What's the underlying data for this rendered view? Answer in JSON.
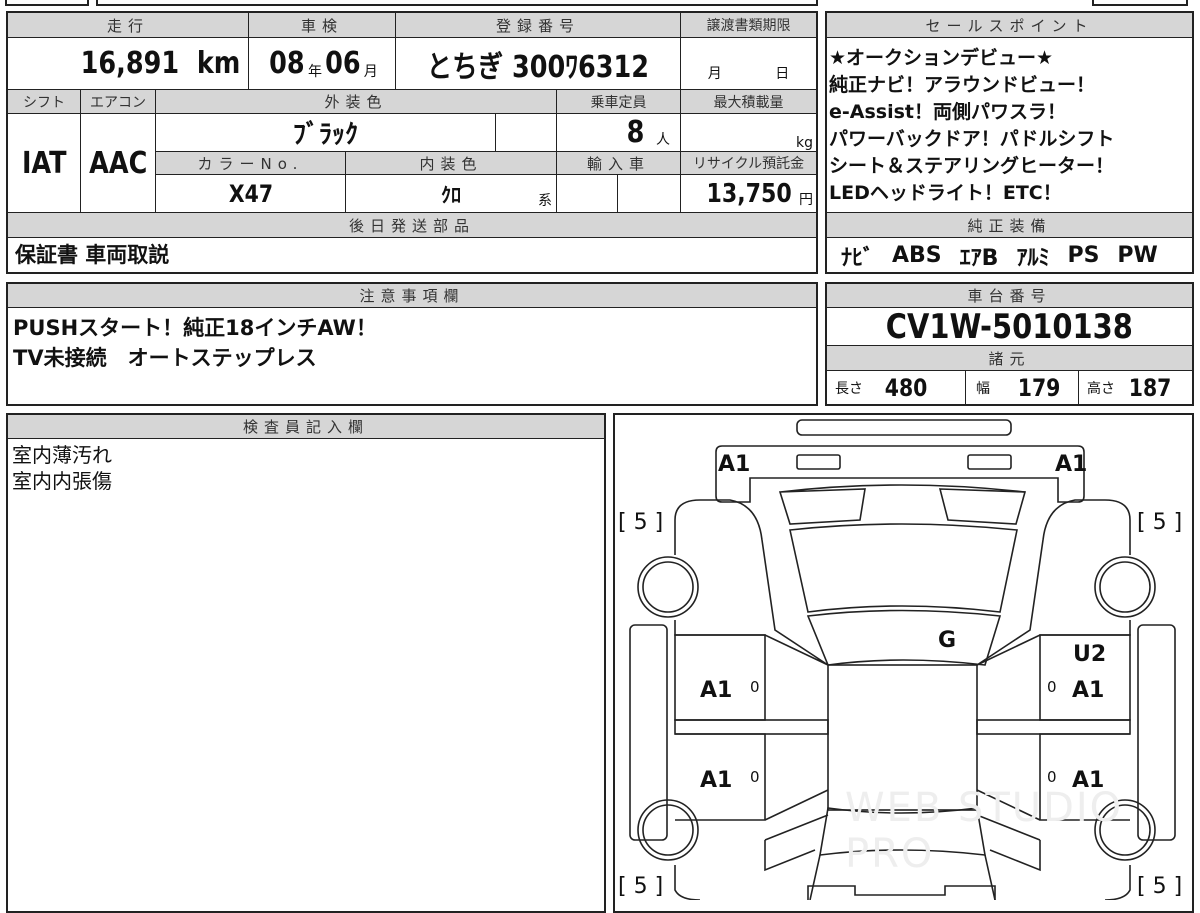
{
  "top_strip": {},
  "vehicle": {
    "mileage_header": "走行",
    "mileage": "16,891",
    "mileage_unit": "km",
    "inspection_header": "車検",
    "inspection_year": "08",
    "year_unit": "年",
    "inspection_month": "06",
    "month_unit": "月",
    "registration_header": "登録番号",
    "registration": "とちぎ 300ﾜ6312",
    "transfer_deadline_header": "譲渡書類期限",
    "month_label": "月",
    "day_label": "日",
    "shift_header": "シフト",
    "shift": "IAT",
    "ac_header": "エアコン",
    "ac": "AAC",
    "exterior_color_header": "外装色",
    "exterior_color": "ﾌﾞﾗｯｸ",
    "capacity_header": "乗車定員",
    "capacity": "8",
    "capacity_unit": "人",
    "max_load_header": "最大積載量",
    "max_load_unit": "kg",
    "color_no_header": "カラーNo.",
    "color_no": "X47",
    "interior_color_header": "内装色",
    "interior_color": "ｸﾛ",
    "interior_suffix": "系",
    "import_header": "輸入車",
    "recycle_header": "リサイクル預託金",
    "recycle_fee": "13,750",
    "recycle_unit": "円",
    "later_parts_header": "後日発送部品",
    "later_parts": "保証書 車両取説"
  },
  "sales_points": {
    "header": "セールスポイント",
    "lines": [
      "★オークションデビュー★",
      "純正ナビ！アラウンドビュー！",
      "e-Assist！両側パワスラ！",
      "パワーバックドア！パドルシフト",
      "シート＆ステアリングヒーター！",
      "LEDヘッドライト！ETC！"
    ],
    "equipment_header": "純正装備",
    "equipment": [
      "ﾅﾋﾞ",
      "ABS",
      "ｴｱB",
      "ｱﾙﾐ",
      "PS",
      "PW"
    ]
  },
  "notes": {
    "header": "注意事項欄",
    "lines": [
      "PUSHスタート！純正18インチAW！",
      "TV未接続　オートステップレス"
    ]
  },
  "chassis": {
    "header": "車台番号",
    "number": "CV1W-5010138",
    "spec_header": "諸元",
    "length_label": "長さ",
    "length": "480",
    "width_label": "幅",
    "width": "179",
    "height_label": "高さ",
    "height": "187"
  },
  "inspector": {
    "header": "検査員記入欄",
    "lines": [
      "室内薄汚れ",
      "室内内張傷"
    ]
  },
  "diagram": {
    "tire_left_rear": "[ 5 ]",
    "tire_right_rear": "[ 5 ]",
    "tire_left_front": "[ 5 ]",
    "tire_right_front": "[ 5 ]",
    "rear_left": "A1",
    "rear_right": "A1",
    "roof": "G",
    "right_rear_quarter": "U2",
    "left_rear_door": "A1",
    "right_rear_door": "A1",
    "left_front_door": "A1",
    "right_front_door": "A1",
    "step_mark": "0",
    "watermark": "WEB STUDIO PRO"
  }
}
